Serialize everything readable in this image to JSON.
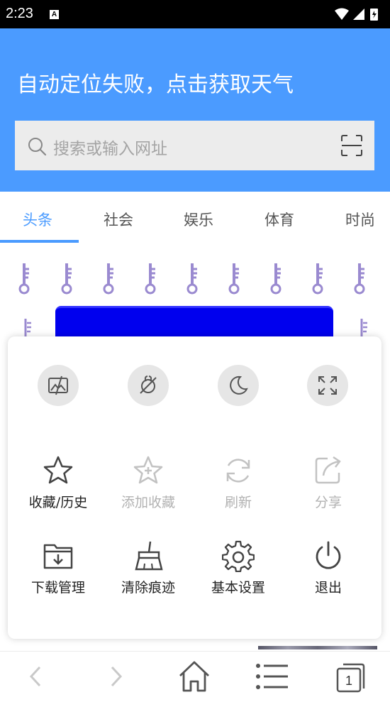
{
  "status_bar": {
    "time": "2:23",
    "notification_icon": "A",
    "icons": [
      "wifi-icon",
      "cell-signal-icon",
      "battery-icon"
    ]
  },
  "header": {
    "weather_message": "自动定位失败，点击获取天气",
    "search": {
      "placeholder": "搜索或输入网址",
      "icon": "search-icon",
      "scan_icon": "scan-icon"
    }
  },
  "tabs": [
    {
      "label": "头条",
      "active": true
    },
    {
      "label": "社会",
      "active": false
    },
    {
      "label": "娱乐",
      "active": false
    },
    {
      "label": "体育",
      "active": false
    },
    {
      "label": "时尚",
      "active": false
    }
  ],
  "menu": {
    "quick_toggles": [
      {
        "icon": "no-image-mode-icon"
      },
      {
        "icon": "no-tracking-icon"
      },
      {
        "icon": "night-mode-icon"
      },
      {
        "icon": "fullscreen-icon"
      }
    ],
    "items": [
      {
        "label": "收藏/历史",
        "icon": "star-icon",
        "enabled": true
      },
      {
        "label": "添加收藏",
        "icon": "star-add-icon",
        "enabled": false
      },
      {
        "label": "刷新",
        "icon": "refresh-icon",
        "enabled": false
      },
      {
        "label": "分享",
        "icon": "share-icon",
        "enabled": false
      },
      {
        "label": "下载管理",
        "icon": "download-folder-icon",
        "enabled": true
      },
      {
        "label": "清除痕迹",
        "icon": "broom-icon",
        "enabled": true
      },
      {
        "label": "基本设置",
        "icon": "gear-icon",
        "enabled": true
      },
      {
        "label": "退出",
        "icon": "power-icon",
        "enabled": true
      }
    ]
  },
  "bottom_nav": {
    "back_icon": "chevron-left-icon",
    "forward_icon": "chevron-right-icon",
    "home_icon": "home-icon",
    "menu_icon": "list-icon",
    "tabs_count": "1"
  },
  "colors": {
    "accent": "#4b9bff",
    "banner": "#0000ee",
    "disabled_text": "#b2b2b2"
  }
}
